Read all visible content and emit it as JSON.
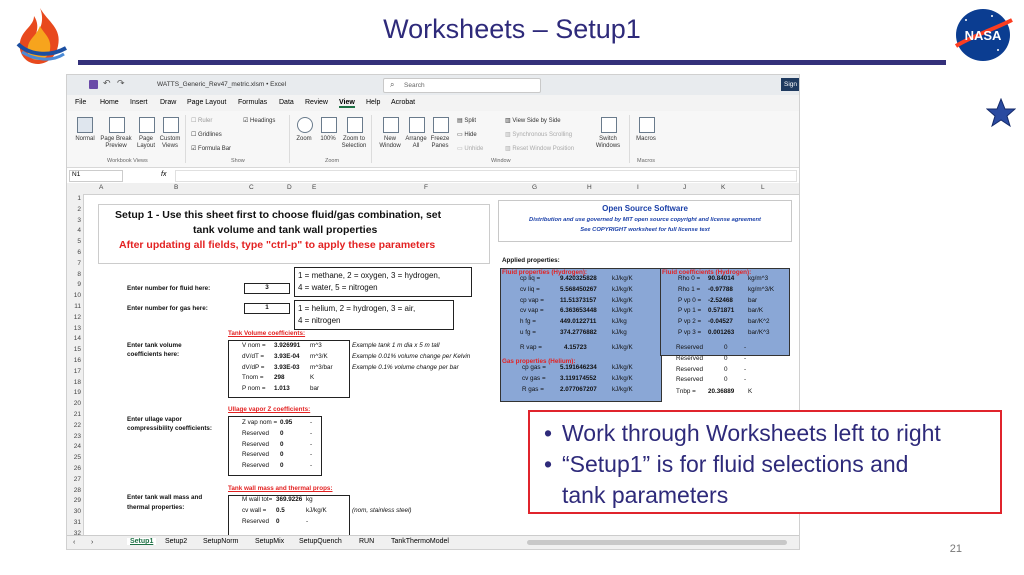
{
  "slide": {
    "title": "Worksheets – Setup1",
    "page_number": "21",
    "bullets": [
      "Work through Worksheets left to right",
      "“Setup1” is for fluid selections and tank parameters"
    ],
    "bullet_line2": "tank parameters",
    "bullet_line2a": "“Setup1” is for fluid selections and",
    "logo_text": "NASA"
  },
  "excel": {
    "file_title": "WATTS_Generic_Rev47_metric.xlsm • Excel",
    "search_placeholder": "Search",
    "signin": "Sign",
    "menu": [
      "File",
      "Home",
      "Insert",
      "Draw",
      "Page Layout",
      "Formulas",
      "Data",
      "Review",
      "View",
      "Help",
      "Acrobat"
    ],
    "active_menu": "View",
    "ribbon": {
      "normal": "Normal",
      "page_break": "Page Break Preview",
      "page_layout": "Page Layout",
      "custom_views": "Custom Views",
      "group_views": "Workbook Views",
      "ruler": "Ruler",
      "headings": "Headings",
      "gridlines": "Gridlines",
      "formula_bar": "Formula Bar",
      "group_show": "Show",
      "zoom": "Zoom",
      "zoom100": "100%",
      "zoom_selection": "Zoom to Selection",
      "group_zoom": "Zoom",
      "new_window": "New Window",
      "arrange_all": "Arrange All",
      "freeze_panes": "Freeze Panes",
      "split": "Split",
      "hide": "Hide",
      "unhide": "Unhide",
      "view_side": "View Side by Side",
      "sync_scroll": "Synchronous Scrolling",
      "reset_pos": "Reset Window Position",
      "switch_windows": "Switch Windows",
      "group_window": "Window",
      "macros": "Macros",
      "group_macros": "Macros"
    },
    "name_box": "N1",
    "fx": "fx",
    "columns": [
      "A",
      "B",
      "C",
      "D",
      "E",
      "F",
      "G",
      "H",
      "I",
      "J",
      "K",
      "L"
    ],
    "rows": [
      "1",
      "2",
      "3",
      "4",
      "5",
      "6",
      "7",
      "8",
      "9",
      "10",
      "11",
      "12",
      "13",
      "14",
      "15",
      "16",
      "17",
      "18",
      "19",
      "20",
      "21",
      "22",
      "23",
      "24",
      "25",
      "26",
      "27",
      "28",
      "29",
      "30",
      "31",
      "32"
    ],
    "setup_line1": "Setup 1 - Use this sheet first to choose fluid/gas combination, set",
    "setup_line2": "tank volume and tank wall properties",
    "setup_line3": "After updating all fields, type \"ctrl-p\" to apply these parameters",
    "fluid_opts_1": "1 = methane,  2 = oxygen,  3 = hydrogen,",
    "fluid_opts_2": "4 = water, 5 = nitrogen",
    "gas_opts_1": "1 = helium,  2 = hydrogen,  3 = air,",
    "gas_opts_2": "4 = nitrogen",
    "fluid_label": "Enter number for fluid here:",
    "fluid_value": "3",
    "gas_label": "Enter number for gas here:",
    "gas_value": "1",
    "tank_label_1": "Enter tank volume",
    "tank_label_2": "coefficients here:",
    "tank_header": "Tank Volume coefficients:",
    "tank_rows": [
      {
        "name": "V nom =",
        "value": "3.926991",
        "unit": "m^3",
        "note": "Example tank 1 m dia x 5 m tall"
      },
      {
        "name": "dV/dT =",
        "value": "3.93E-04",
        "unit": "m^3/K",
        "note": "Example 0.01% volume change per Kelvin"
      },
      {
        "name": "dV/dP =",
        "value": "3.93E-03",
        "unit": "m^3/bar",
        "note": "Example 0.1% volume change per bar"
      },
      {
        "name": "Tnom =",
        "value": "298",
        "unit": "K",
        "note": ""
      },
      {
        "name": "P nom =",
        "value": "1.013",
        "unit": "bar",
        "note": ""
      }
    ],
    "ullage_label_1": "Enter ullage vapor",
    "ullage_label_2": "compressibility coefficients:",
    "ullage_header": "Ullage vapor Z coefficients:",
    "ullage_rows": [
      {
        "name": "Z vap nom =",
        "value": "0.95",
        "unit": "-"
      },
      {
        "name": "Reserved",
        "value": "0",
        "unit": "-"
      },
      {
        "name": "Reserved",
        "value": "0",
        "unit": "-"
      },
      {
        "name": "Reserved",
        "value": "0",
        "unit": "-"
      },
      {
        "name": "Reserved",
        "value": "0",
        "unit": "-"
      }
    ],
    "wall_label_1": "Enter tank wall mass and",
    "wall_label_2": "thermal properties:",
    "wall_header": "Tank wall mass and thermal props:",
    "wall_rows": [
      {
        "name": "M wall tot=",
        "value": "369.9226",
        "unit": "kg",
        "note": ""
      },
      {
        "name": "cv wall =",
        "value": "0.5",
        "unit": "kJ/kg/K",
        "note": "(nom, stainless steel)"
      },
      {
        "name": "Reserved",
        "value": "0",
        "unit": "-",
        "note": ""
      }
    ],
    "oss_title": "Open Source Software",
    "oss_line1": "Distribution and use governed by MIT open source copyright and license agreement",
    "oss_line2": "See COPYRIGHT worksheet for full license text",
    "applied": "Applied properties:",
    "fluid_props_header": "Fluid properties (Hydrogen):",
    "fluid_coeff_header": "Fluid coefficients (Hydrogen):",
    "gas_props_header": "Gas properties (Helium):",
    "fluid_props": [
      {
        "name": "cp liq =",
        "value": "9.420325828",
        "unit": "kJ/kg/K"
      },
      {
        "name": "cv liq =",
        "value": "5.568450267",
        "unit": "kJ/kg/K"
      },
      {
        "name": "cp vap =",
        "value": "11.51373157",
        "unit": "kJ/kg/K"
      },
      {
        "name": "cv vap =",
        "value": "6.363653448",
        "unit": "kJ/kg/K"
      },
      {
        "name": "h fg =",
        "value": "449.0122711",
        "unit": "kJ/kg"
      },
      {
        "name": "u fg =",
        "value": "374.2776882",
        "unit": "kJ/kg"
      }
    ],
    "r_vap": {
      "name": "R vap =",
      "value": "4.15723",
      "unit": "kJ/kg/K"
    },
    "gas_props": [
      {
        "name": "cp gas =",
        "value": "5.191646234",
        "unit": "kJ/kg/K"
      },
      {
        "name": "cv gas =",
        "value": "3.119174552",
        "unit": "kJ/kg/K"
      },
      {
        "name": "R gas =",
        "value": "2.077067207",
        "unit": "kJ/kg/K"
      }
    ],
    "fluid_coeffs": [
      {
        "name": "Rho 0 =",
        "value": "90.84014",
        "unit": "kg/m^3"
      },
      {
        "name": "Rho 1 =",
        "value": "-0.97788",
        "unit": "kg/m^3/K"
      },
      {
        "name": "P vp 0 =",
        "value": "-2.52468",
        "unit": "bar"
      },
      {
        "name": "P vp 1 =",
        "value": "0.571871",
        "unit": "bar/K"
      },
      {
        "name": "P vp 2 =",
        "value": "-0.04527",
        "unit": "bar/K^2"
      },
      {
        "name": "P vp 3 =",
        "value": "0.001263",
        "unit": "bar/K^3"
      }
    ],
    "reserved_coeffs": [
      {
        "name": "Reserved",
        "value": "0",
        "unit": "-"
      },
      {
        "name": "Reserved",
        "value": "0",
        "unit": "-"
      },
      {
        "name": "Reserved",
        "value": "0",
        "unit": "-"
      },
      {
        "name": "Reserved",
        "value": "0",
        "unit": "-"
      }
    ],
    "tnbp": {
      "name": "Tnbp =",
      "value": "20.36889",
      "unit": "K"
    },
    "sheets": [
      "Setup1",
      "Setup2",
      "SetupNorm",
      "SetupMix",
      "SetupQuench",
      "RUN",
      "TankThermoModel"
    ],
    "active_sheet": "Setup1"
  },
  "colors": {
    "title": "#2e2a7a",
    "callout_border": "#e0242c",
    "blue_cells": "#8aa7d6",
    "red_header": "#e32222"
  }
}
